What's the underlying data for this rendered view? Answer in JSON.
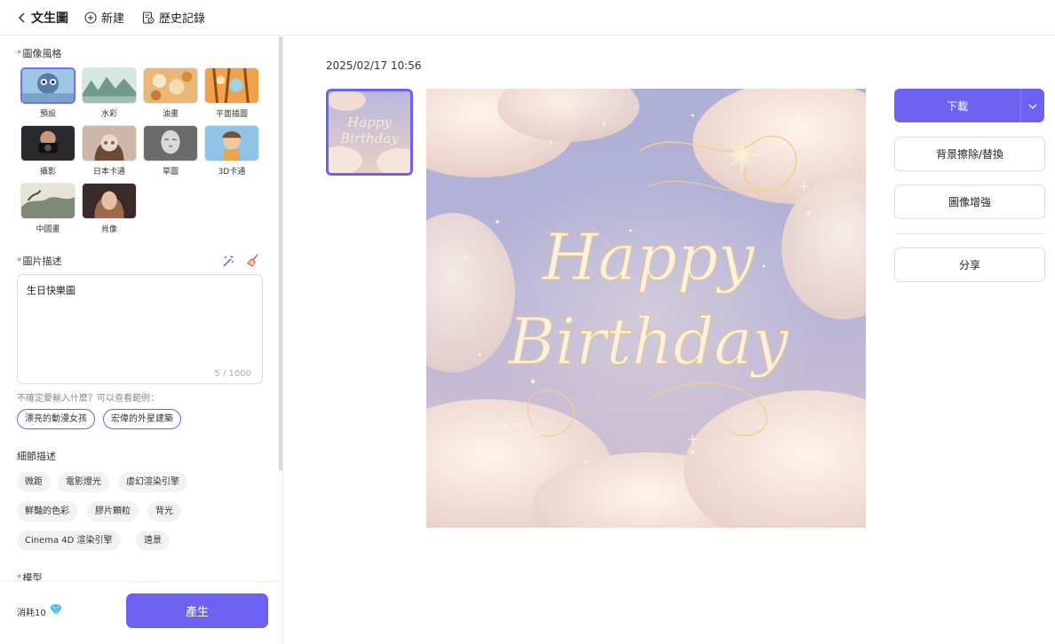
{
  "topbar": {
    "title": "文生圖",
    "new_label": "新建",
    "history_label": "歷史記錄"
  },
  "left_panel": {
    "style_section_label": "圖像風格",
    "styles": [
      {
        "label": "預設"
      },
      {
        "label": "水彩"
      },
      {
        "label": "油畫"
      },
      {
        "label": "平面插圖"
      },
      {
        "label": "攝影"
      },
      {
        "label": "日本卡通"
      },
      {
        "label": "草圖"
      },
      {
        "label": "3D卡通"
      },
      {
        "label": "中國畫"
      },
      {
        "label": "肖像"
      }
    ],
    "selected_style": "預設",
    "prompt_section_label": "圖片描述",
    "prompt_value": "生日快樂圖",
    "prompt_count": "5 / 1000",
    "hint_text": "不確定要輸入什麼？可以查看範例：",
    "examples": [
      "漂亮的動漫女孩",
      "宏偉的外星建築"
    ],
    "detail_section_label": "細節描述",
    "detail_tags": [
      "微距",
      "電影燈光",
      "虛幻渲染引擎",
      "鮮豔的色彩",
      "膠片顆粒",
      "背光",
      "Cinema 4D 渲染引擎",
      "遠景"
    ],
    "model_section_label": "模型",
    "cost_label": "消耗10",
    "generate_label": "產生"
  },
  "main": {
    "timestamp": "2025/02/17 10:56",
    "image_text_line1": "Happy",
    "image_text_line2": "Birthday",
    "actions": {
      "download": "下載",
      "bg_remove": "背景擦除/替換",
      "enhance": "圖像增強",
      "share": "分享"
    }
  },
  "colors": {
    "accent": "#6c61f0",
    "required": "#e8543a"
  }
}
